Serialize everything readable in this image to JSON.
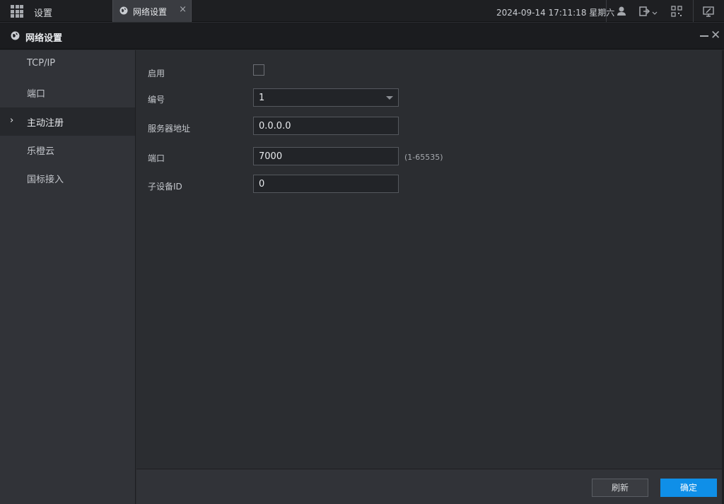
{
  "topbar": {
    "title": "设置",
    "tab_label": "网络设置",
    "tab_close": "×",
    "datetime": "2024-09-14 17:11:18 星期六"
  },
  "window": {
    "title": "网络设置",
    "close": "✕"
  },
  "sidebar": {
    "items": [
      {
        "label": "TCP/IP"
      },
      {
        "label": "端口"
      },
      {
        "label": "主动注册"
      },
      {
        "label": "乐橙云"
      },
      {
        "label": "国标接入"
      }
    ],
    "active_marker": "›"
  },
  "form": {
    "enable_label": "启用",
    "number_label": "编号",
    "number_value": "1",
    "server_label": "服务器地址",
    "server_value": "0.0.0.0",
    "port_label": "端口",
    "port_value": "7000",
    "port_hint": "(1-65535)",
    "subdevice_label": "子设备ID",
    "subdevice_value": "0"
  },
  "buttons": {
    "refresh": "刷新",
    "ok": "确定"
  },
  "colors": {
    "accent": "#0f8fe8",
    "background": "#2b2d31",
    "sidebar": "#313338"
  }
}
